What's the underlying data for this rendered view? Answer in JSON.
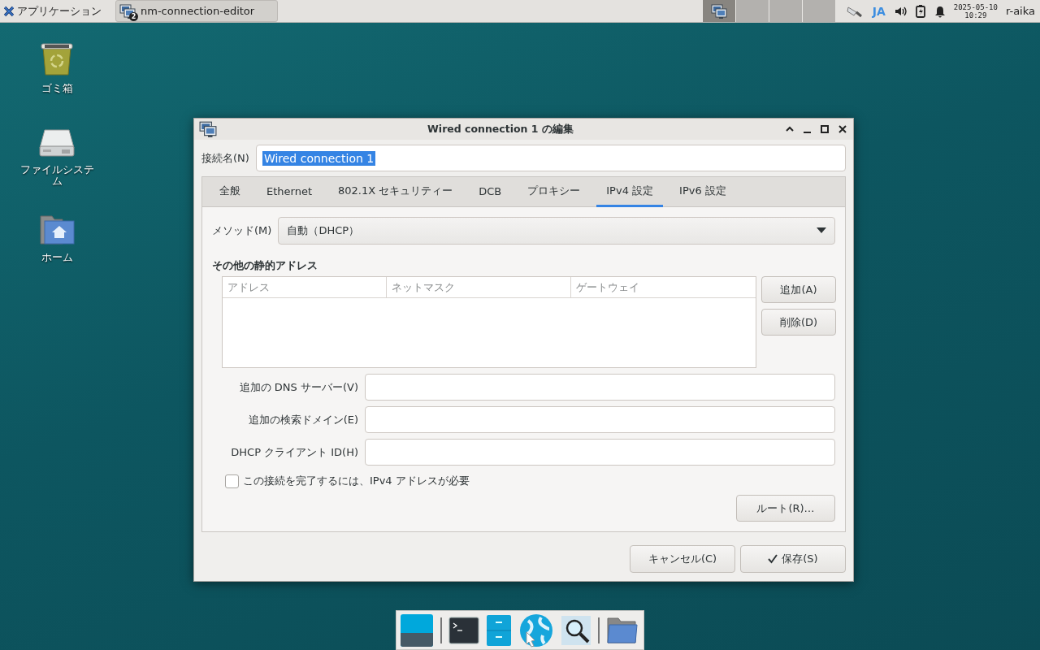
{
  "panel": {
    "app_menu": "アプリケーション",
    "tasks": [
      {
        "title": "nm-connection-editor",
        "badge": "2"
      }
    ],
    "workspaces": [
      {
        "selected": true
      },
      {
        "selected": false
      },
      {
        "selected": false
      },
      {
        "selected": false
      }
    ],
    "keyboard": "JA",
    "date": "2025-05-10",
    "time": "10:29",
    "user": "r-aika"
  },
  "desktop_icons": [
    {
      "kind": "trash",
      "label": "ゴミ箱"
    },
    {
      "kind": "drive",
      "label": "ファイルシステム"
    },
    {
      "kind": "home",
      "label": "ホーム"
    }
  ],
  "dialog": {
    "title": "Wired connection 1 の編集",
    "name_label": "接続名(N)",
    "name_value": "Wired connection 1",
    "name_text_selected": true,
    "tabs": [
      {
        "label": "全般",
        "selected": false
      },
      {
        "label": "Ethernet",
        "selected": false
      },
      {
        "label": "802.1X セキュリティー",
        "selected": false
      },
      {
        "label": "DCB",
        "selected": false
      },
      {
        "label": "プロキシー",
        "selected": false
      },
      {
        "label": "IPv4 設定",
        "selected": true
      },
      {
        "label": "IPv6 設定",
        "selected": false
      }
    ],
    "method_label": "メソッド(M)",
    "method_value": "自動（DHCP）",
    "addresses_heading": "その他の静的アドレス",
    "address_columns": [
      "アドレス",
      "ネットマスク",
      "ゲートウェイ"
    ],
    "address_buttons": [
      "追加(A)",
      "削除(D)"
    ],
    "fields": [
      {
        "label": "追加の  DNS サーバー(V)"
      },
      {
        "label": "追加の検索ドメイン(E)"
      },
      {
        "label": "DHCP クライアント  ID(H)"
      }
    ],
    "require_ipv4": {
      "label": "この接続を完了するには、IPv4 アドレスが必要",
      "checked": false
    },
    "routes_button": "ルート(R)…",
    "buttons": [
      {
        "label": "キャンセル(C)",
        "kind": "plain"
      },
      {
        "label": "保存(S)",
        "kind": "confirm"
      }
    ]
  },
  "dock": [
    {
      "kind": "show-desktop"
    },
    {
      "kind": "terminal"
    },
    {
      "kind": "file-cabinet"
    },
    {
      "kind": "web-browser"
    },
    {
      "kind": "search"
    },
    {
      "kind": "folder"
    }
  ]
}
